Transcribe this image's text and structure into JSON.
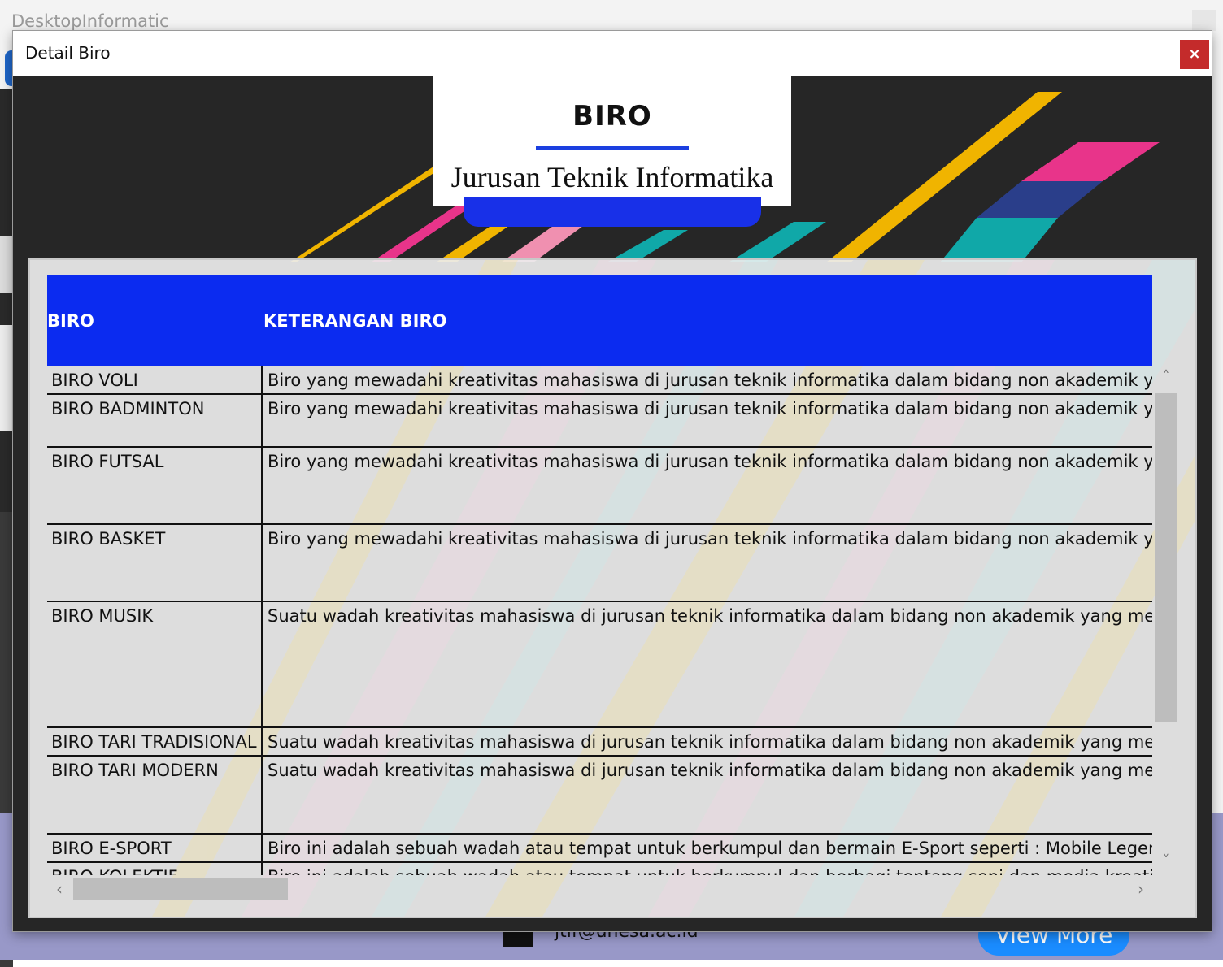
{
  "background_app": {
    "title": "DesktopInformatic",
    "footer_email": "jtif@unesa.ac.id",
    "footer_button": "View More"
  },
  "dialog": {
    "title": "Detail Biro",
    "close_label": "×"
  },
  "banner": {
    "title": "BIRO",
    "subtitle": "Jurusan Teknik Informatika"
  },
  "table": {
    "columns": [
      "BIRO",
      "KETERANGAN BIRO"
    ],
    "rows": [
      {
        "biro": "BIRO VOLI",
        "keterangan": "Biro yang mewadahi kreativitas mahasiswa di jurusan teknik informatika dalam bidang non akademik yang"
      },
      {
        "biro": "BIRO BADMINTON",
        "keterangan": "Biro yang mewadahi kreativitas mahasiswa di jurusan teknik informatika dalam bidang non akademik yang"
      },
      {
        "biro": "BIRO FUTSAL",
        "keterangan": "Biro yang mewadahi kreativitas mahasiswa di jurusan teknik informatika dalam bidang non akademik yang"
      },
      {
        "biro": "BIRO BASKET",
        "keterangan": "Biro yang mewadahi kreativitas mahasiswa di jurusan teknik informatika dalam bidang non akademik yang"
      },
      {
        "biro": "BIRO MUSIK",
        "keterangan": "Suatu wadah kreativitas mahasiswa di jurusan teknik informatika dalam bidang non akademik yang menga"
      },
      {
        "biro": "BIRO TARI TRADISIONAL",
        "keterangan": "Suatu wadah kreativitas mahasiswa di jurusan teknik informatika dalam bidang non akademik yang menga"
      },
      {
        "biro": "BIRO TARI MODERN",
        "keterangan": "Suatu wadah kreativitas mahasiswa di jurusan teknik informatika dalam bidang non akademik yang menga"
      },
      {
        "biro": "BIRO E-SPORT",
        "keterangan": "Biro ini adalah sebuah wadah atau tempat untuk berkumpul dan bermain E-Sport seperti : Mobile Legend,"
      },
      {
        "biro": "BIRO KOLEKTIF",
        "keterangan": "Biro ini adalah sebuah wadah atau tempat untuk berkumpul dan berbagi tentang seni dan media kreatif"
      }
    ]
  },
  "scrollbars": {
    "up_arrow": "˄",
    "down_arrow": "˅",
    "left_arrow": "‹",
    "right_arrow": "›"
  }
}
